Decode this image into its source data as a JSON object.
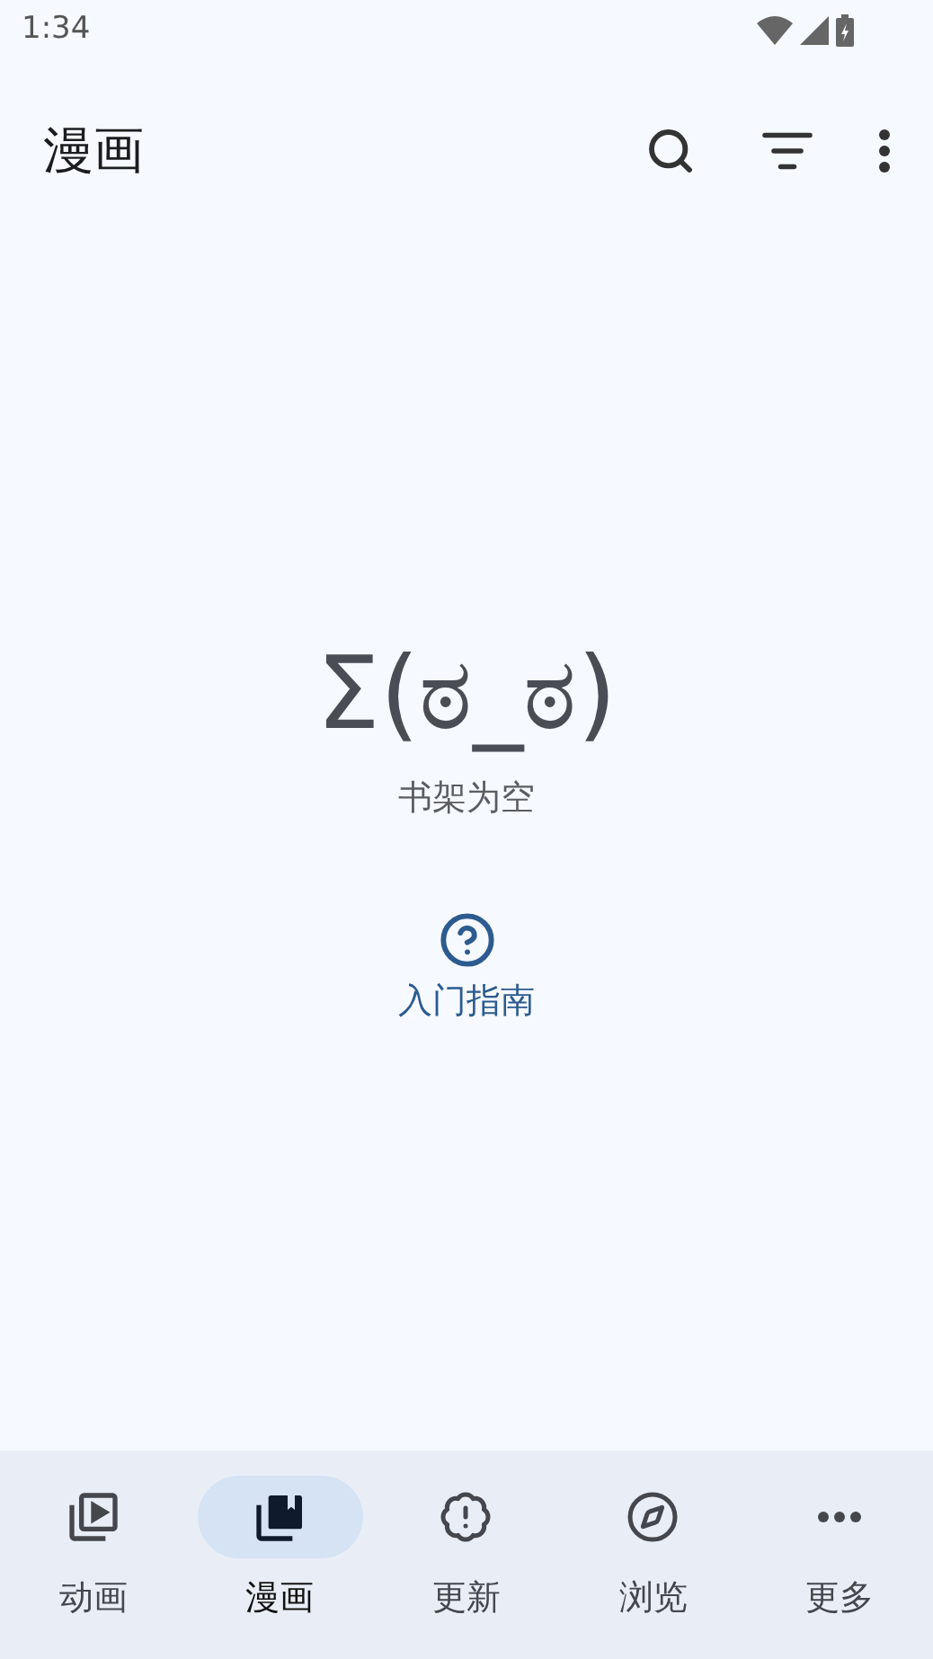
{
  "status_bar": {
    "time": "1:34"
  },
  "app_bar": {
    "title": "漫画"
  },
  "empty_state": {
    "face": "Σ(ಠ_ಠ)",
    "message": "书架为空",
    "help_link": "入门指南"
  },
  "bottom_nav": [
    {
      "label": "动画",
      "kind": "anime",
      "selected": false
    },
    {
      "label": "漫画",
      "kind": "manga",
      "selected": true
    },
    {
      "label": "更新",
      "kind": "updates",
      "selected": false
    },
    {
      "label": "浏览",
      "kind": "browse",
      "selected": false
    },
    {
      "label": "更多",
      "kind": "more",
      "selected": false
    }
  ]
}
